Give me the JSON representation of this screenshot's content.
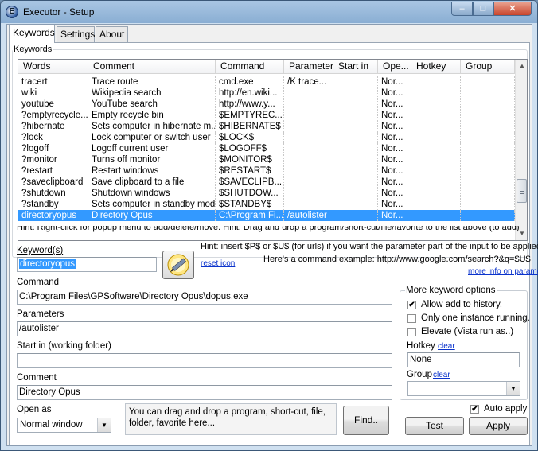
{
  "window": {
    "title": "Executor - Setup",
    "app_icon_letter": "E",
    "min_glyph": "–",
    "max_glyph": "□",
    "close_glyph": "✕"
  },
  "tabs": [
    {
      "label": "Keywords"
    },
    {
      "label": "Settings"
    },
    {
      "label": "About"
    }
  ],
  "keywords_group": {
    "label": "Keywords"
  },
  "list": {
    "columns": [
      "Words",
      "Comment",
      "Command",
      "Parameter",
      "Start in",
      "Ope...",
      "Hotkey",
      "Group"
    ],
    "rows": [
      [
        "tracert",
        "Trace route",
        "cmd.exe",
        "/K trace...",
        "",
        "Nor...",
        "",
        ""
      ],
      [
        "wiki",
        "Wikipedia search",
        "http://en.wiki...",
        "",
        "",
        "Nor...",
        "",
        ""
      ],
      [
        "youtube",
        "YouTube search",
        "http://www.y...",
        "",
        "",
        "Nor...",
        "",
        ""
      ],
      [
        "?emptyrecycle...",
        "Empty recycle bin",
        "$EMPTYREC...",
        "",
        "",
        "Nor...",
        "",
        ""
      ],
      [
        "?hibernate",
        "Sets computer in hibernate m...",
        "$HIBERNATE$",
        "",
        "",
        "Nor...",
        "",
        ""
      ],
      [
        "?lock",
        "Lock computer or switch user",
        "$LOCK$",
        "",
        "",
        "Nor...",
        "",
        ""
      ],
      [
        "?logoff",
        "Logoff current user",
        "$LOGOFF$",
        "",
        "",
        "Nor...",
        "",
        ""
      ],
      [
        "?monitor",
        "Turns off monitor",
        "$MONITOR$",
        "",
        "",
        "Nor...",
        "",
        ""
      ],
      [
        "?restart",
        "Restart windows",
        "$RESTART$",
        "",
        "",
        "Nor...",
        "",
        ""
      ],
      [
        "?saveclipboard",
        "Save clipboard to a file",
        "$SAVECLIPB...",
        "",
        "",
        "Nor...",
        "",
        ""
      ],
      [
        "?shutdown",
        "Shutdown windows",
        "$SHUTDOW...",
        "",
        "",
        "Nor...",
        "",
        ""
      ],
      [
        "?standby",
        "Sets computer in standby mode",
        "$STANDBY$",
        "",
        "",
        "Nor...",
        "",
        ""
      ],
      [
        "directoryopus",
        "Directory Opus",
        "C:\\Program Fi...",
        "/autolister",
        "",
        "Nor...",
        "",
        ""
      ]
    ],
    "selected_index": 12,
    "scroll_up": "▲",
    "scroll_down": "▼"
  },
  "list_hint": "Hint: Right-click for popup menu to add/delete/move.     Hint: Drag and drop a program/short-cut/file/favorite to the list above (to add)",
  "form": {
    "keyword_label": "Keyword(s)",
    "keyword_value": "directoryopus",
    "reset_icon_link": "reset icon",
    "hint_line1": "Hint: insert $P$ or $U$ (for urls) if you want the parameter part of the input to be applied.",
    "hint_line2": "Here's a command example: http://www.google.com/search?&q=$U$",
    "more_info_link": "more info on parameters",
    "command_label": "Command",
    "command_value": "C:\\Program Files\\GPSoftware\\Directory Opus\\dopus.exe",
    "parameters_label": "Parameters",
    "parameters_value": "/autolister",
    "startin_label": "Start in (working folder)",
    "startin_value": "",
    "comment_label": "Comment",
    "comment_value": "Directory Opus",
    "openas_label": "Open as",
    "openas_value": "Normal window",
    "dropzone_text": "You can drag and drop a program, short-cut, file, folder, favorite here...",
    "find_label": "Find.."
  },
  "options": {
    "group_label": "More keyword options",
    "allow_history": "Allow add to history.",
    "allow_history_checked": true,
    "one_instance": "Only one instance running.",
    "one_instance_checked": false,
    "elevate": "Elevate (Vista run as..)",
    "elevate_checked": false,
    "hotkey_label": "Hotkey",
    "hotkey_clear": "clear",
    "hotkey_value": "None",
    "group_field_label": "Group",
    "group_clear": "clear",
    "group_value": ""
  },
  "bottom": {
    "auto_apply_label": "Auto apply",
    "auto_apply_checked": true,
    "test_label": "Test",
    "apply_label": "Apply",
    "check_glyph": "✔"
  },
  "colors": {
    "selection": "#3399ff",
    "link": "#0b33cc",
    "title_bar": "#8aaed3"
  }
}
